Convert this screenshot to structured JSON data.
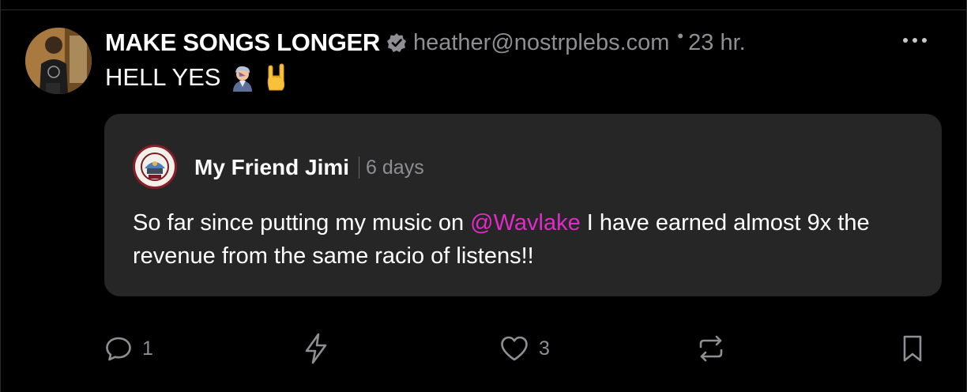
{
  "post": {
    "author": {
      "display_name": "MAKE SONGS LONGER",
      "handle": "heather@nostrplebs.com",
      "verified_icon": "verified-badge-icon"
    },
    "time_separator": "•",
    "time": "23 hr.",
    "text": "HELL YES",
    "emojis": [
      "singer-emoji",
      "sign-of-the-horns-emoji"
    ]
  },
  "quote": {
    "author_name": "My Friend Jimi",
    "time": "6 days",
    "body_before": "So far since putting my music on ",
    "mention": "@Wavlake",
    "body_after": " I have earned almost 9x the revenue from the same racio of listens!!",
    "mention_color": "#e02bc8"
  },
  "actions": {
    "reply": {
      "icon": "reply-icon",
      "count": "1"
    },
    "zap": {
      "icon": "zap-icon"
    },
    "like": {
      "icon": "heart-icon",
      "count": "3"
    },
    "repost": {
      "icon": "repost-icon"
    },
    "bookmark": {
      "icon": "bookmark-icon"
    }
  },
  "colors": {
    "background": "#000000",
    "card": "#262626",
    "muted_text": "#8e8e93",
    "accent": "#e02bc8"
  }
}
